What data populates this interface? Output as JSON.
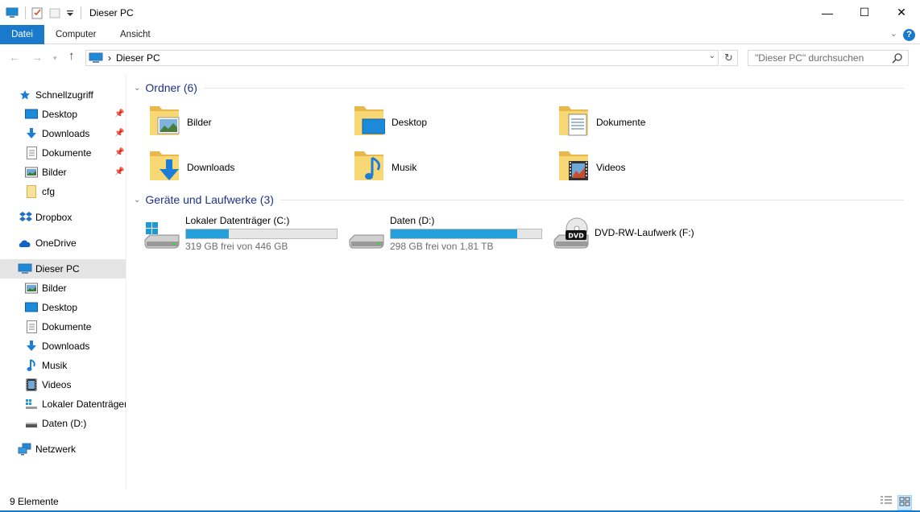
{
  "window": {
    "title": "Dieser PC",
    "controls": [
      "—",
      "☐",
      "✕"
    ]
  },
  "ribbon": {
    "tabs": [
      {
        "label": "Datei",
        "active": true
      },
      {
        "label": "Computer",
        "active": false
      },
      {
        "label": "Ansicht",
        "active": false
      }
    ],
    "help": "?"
  },
  "nav": {
    "breadcrumb_sep": "›",
    "address": "Dieser PC",
    "search_placeholder": "\"Dieser PC\" durchsuchen"
  },
  "sidebar": {
    "quick_access": "Schnellzugriff",
    "quick_items": [
      {
        "label": "Desktop",
        "icon": "desktop-icon",
        "pinned": true
      },
      {
        "label": "Downloads",
        "icon": "download-icon",
        "pinned": true
      },
      {
        "label": "Dokumente",
        "icon": "document-icon",
        "pinned": true
      },
      {
        "label": "Bilder",
        "icon": "pictures-icon",
        "pinned": true
      },
      {
        "label": "cfg",
        "icon": "folder-icon",
        "pinned": false
      }
    ],
    "dropbox": "Dropbox",
    "onedrive": "OneDrive",
    "this_pc": "Dieser PC",
    "pc_items": [
      {
        "label": "Bilder",
        "icon": "pictures-icon"
      },
      {
        "label": "Desktop",
        "icon": "desktop-icon"
      },
      {
        "label": "Dokumente",
        "icon": "document-icon"
      },
      {
        "label": "Downloads",
        "icon": "download-icon"
      },
      {
        "label": "Musik",
        "icon": "music-icon"
      },
      {
        "label": "Videos",
        "icon": "video-icon"
      },
      {
        "label": "Lokaler Datenträger",
        "icon": "drive-windows-icon"
      },
      {
        "label": "Daten (D:)",
        "icon": "drive-icon"
      }
    ],
    "network": "Netzwerk"
  },
  "groups": {
    "folders": "Ordner (6)",
    "devices": "Geräte und Laufwerke (3)"
  },
  "folders": [
    {
      "label": "Bilder",
      "icon": "pictures-folder-icon"
    },
    {
      "label": "Desktop",
      "icon": "desktop-folder-icon"
    },
    {
      "label": "Dokumente",
      "icon": "documents-folder-icon"
    },
    {
      "label": "Downloads",
      "icon": "downloads-folder-icon"
    },
    {
      "label": "Musik",
      "icon": "music-folder-icon"
    },
    {
      "label": "Videos",
      "icon": "videos-folder-icon"
    }
  ],
  "drives": [
    {
      "label": "Lokaler Datenträger (C:)",
      "free": "319 GB frei von 446 GB",
      "used_fraction": 0.285
    },
    {
      "label": "Daten (D:)",
      "free": "298 GB frei von 1,81 TB",
      "used_fraction": 0.839
    },
    {
      "label": "DVD-RW-Laufwerk (F:)"
    }
  ],
  "dvd_label": "DVD",
  "status": {
    "count": "9 Elemente"
  },
  "colors": {
    "accent": "#1979ca",
    "bar_fill": "#26a0da",
    "group_title": "#1e3287",
    "folder": "#f8d775"
  }
}
